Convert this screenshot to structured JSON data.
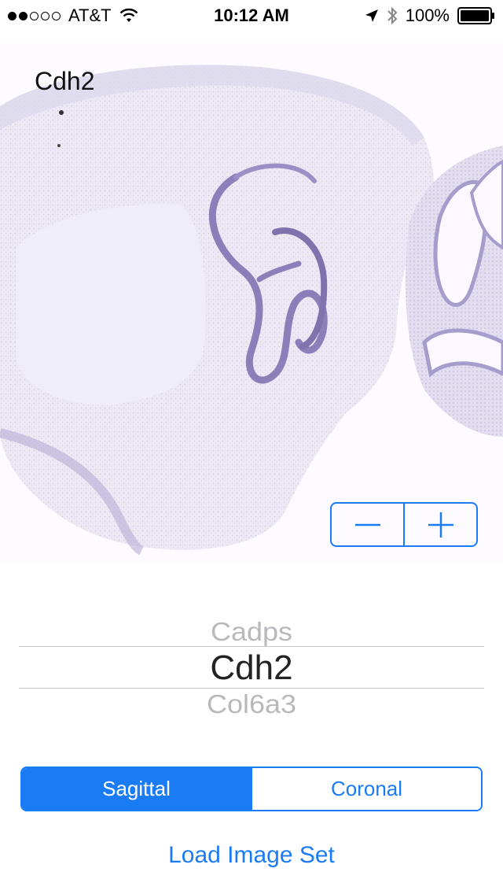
{
  "status_bar": {
    "carrier": "AT&T",
    "time": "10:12 AM",
    "battery": "100%",
    "signal_bars_filled": 2,
    "signal_bars_total": 5
  },
  "viewer": {
    "gene_label": "Cdh2"
  },
  "picker": {
    "items_visible": [
      "Cadps",
      "Cdh2",
      "Col6a3"
    ],
    "selected": "Cdh2"
  },
  "segmented": {
    "options": [
      "Sagittal",
      "Coronal"
    ],
    "selected_index": 0
  },
  "actions": {
    "load_label": "Load Image Set"
  },
  "colors": {
    "accent": "#1a7cf5",
    "stain": "#8a7fb8",
    "tissue": "#ebe8f4"
  }
}
